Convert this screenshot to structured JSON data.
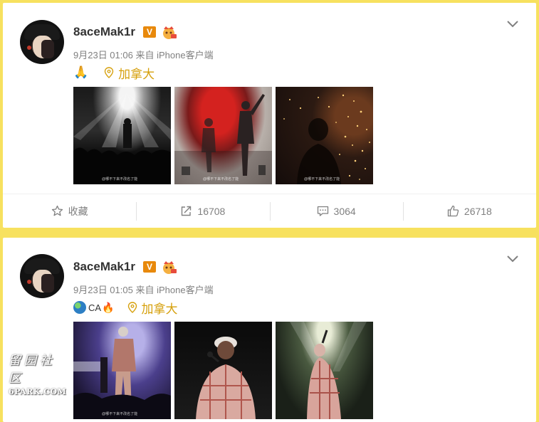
{
  "posts": [
    {
      "username": "8aceMak1r",
      "verified_badge": "V",
      "timestamp": "9月23日 01:06",
      "source_prefix": "来自",
      "source": "iPhone客户端",
      "text_emoji": "🙏",
      "location": "加拿大",
      "photo_watermarks": [
        "@哪不下来不改名了能",
        "@哪不下来不改名了能",
        "@哪不下来不改名了能"
      ],
      "actions": {
        "favorite_label": "收藏",
        "repost_count": "16708",
        "comment_count": "3064",
        "like_count": "26718"
      }
    },
    {
      "username": "8aceMak1r",
      "verified_badge": "V",
      "timestamp": "9月23日 01:05",
      "source_prefix": "来自",
      "source": "iPhone客户端",
      "text_ca": "CA",
      "text_fire": "🔥",
      "location": "加拿大",
      "photo_watermarks": [
        "@哪不下来不改名了能"
      ]
    }
  ],
  "site_watermark": {
    "cn": "留园社区",
    "en": "6PARK.COM"
  },
  "colors": {
    "background": "#f7e15f",
    "location": "#d6a00c",
    "verified": "#e8890c"
  }
}
